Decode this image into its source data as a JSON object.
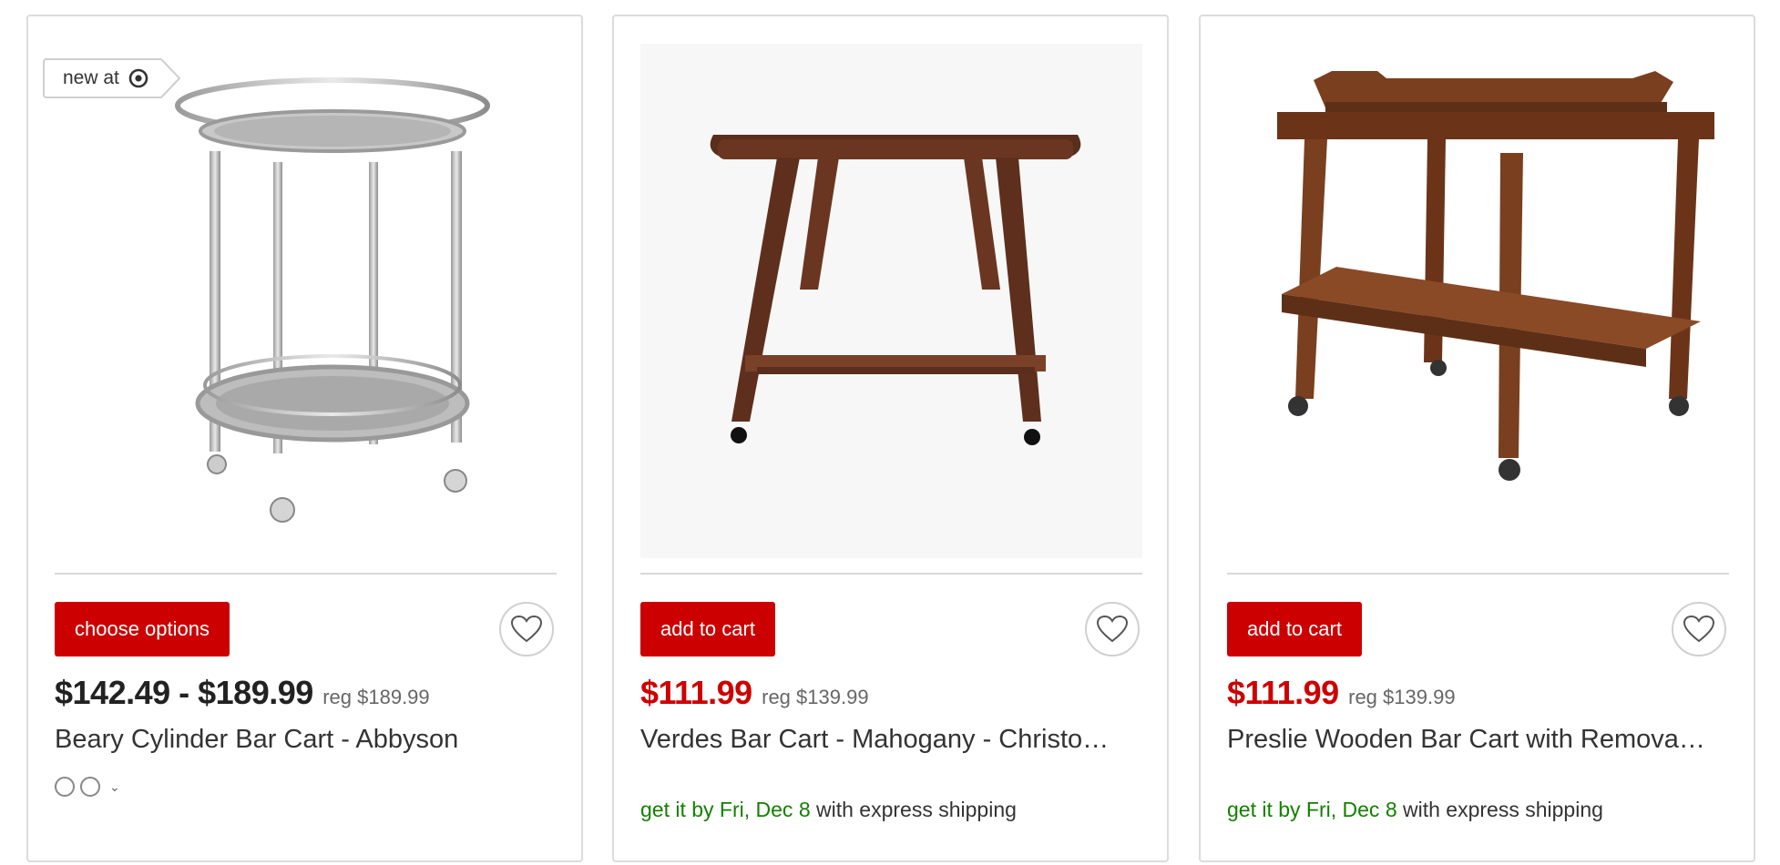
{
  "colors": {
    "brand_red": "#cc0000",
    "ship_green": "#138000",
    "border": "#dcdcdc"
  },
  "badge": {
    "label": "new at",
    "icon": "target-logo-icon"
  },
  "products": [
    {
      "button_label": "choose options",
      "price": "$142.49 - $189.99",
      "price_style": "regular",
      "reg_price": "reg $189.99",
      "title": "Beary Cylinder Bar Cart - Abbyson",
      "swatch_count": 2,
      "image_icon": "silver-round-bar-cart-image"
    },
    {
      "button_label": "add to cart",
      "price": "$111.99",
      "price_style": "sale",
      "reg_price": "reg $139.99",
      "title": "Verdes Bar Cart - Mahogany - Christo…",
      "ship_green": "get it by Fri, Dec 8",
      "ship_rest": " with express shipping",
      "image_icon": "mahogany-bar-cart-image"
    },
    {
      "button_label": "add to cart",
      "price": "$111.99",
      "price_style": "sale",
      "reg_price": "reg $139.99",
      "title": "Preslie Wooden Bar Cart with Remova…",
      "ship_green": "get it by Fri, Dec 8",
      "ship_rest": " with express shipping",
      "image_icon": "wooden-tray-bar-cart-image"
    }
  ]
}
